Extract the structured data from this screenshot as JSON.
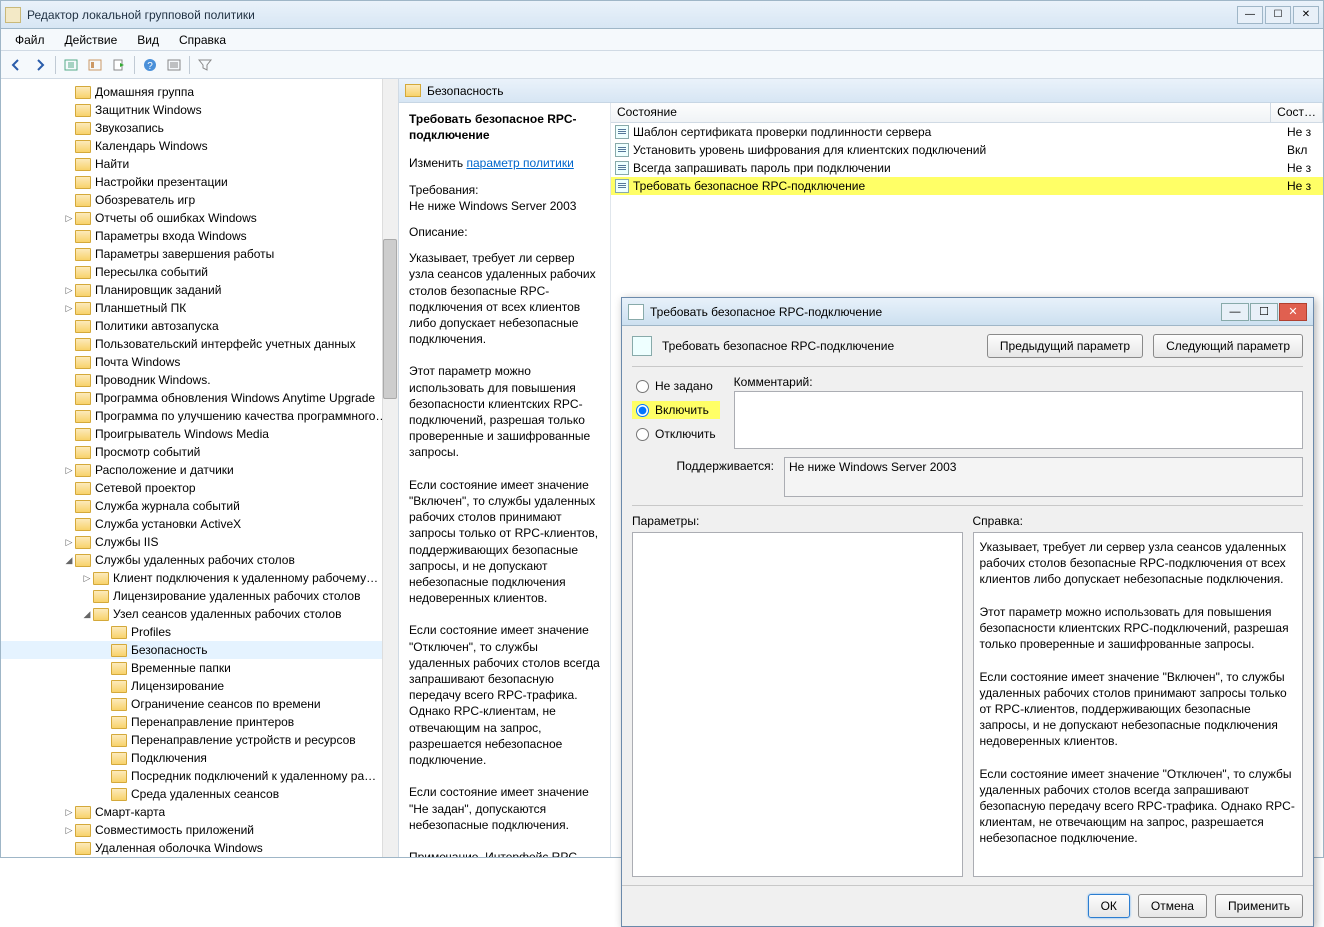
{
  "window": {
    "title": "Редактор локальной групповой политики"
  },
  "menubar": [
    "Файл",
    "Действие",
    "Вид",
    "Справка"
  ],
  "tree": [
    {
      "indent": 3,
      "exp": "",
      "label": "Домашняя группа"
    },
    {
      "indent": 3,
      "exp": "",
      "label": "Защитник Windows"
    },
    {
      "indent": 3,
      "exp": "",
      "label": "Звукозапись"
    },
    {
      "indent": 3,
      "exp": "",
      "label": "Календарь Windows"
    },
    {
      "indent": 3,
      "exp": "",
      "label": "Найти"
    },
    {
      "indent": 3,
      "exp": "",
      "label": "Настройки презентации"
    },
    {
      "indent": 3,
      "exp": "",
      "label": "Обозреватель игр"
    },
    {
      "indent": 3,
      "exp": "▷",
      "label": "Отчеты об ошибках Windows"
    },
    {
      "indent": 3,
      "exp": "",
      "label": "Параметры входа Windows"
    },
    {
      "indent": 3,
      "exp": "",
      "label": "Параметры завершения работы"
    },
    {
      "indent": 3,
      "exp": "",
      "label": "Пересылка событий"
    },
    {
      "indent": 3,
      "exp": "▷",
      "label": "Планировщик заданий"
    },
    {
      "indent": 3,
      "exp": "▷",
      "label": "Планшетный ПК"
    },
    {
      "indent": 3,
      "exp": "",
      "label": "Политики автозапуска"
    },
    {
      "indent": 3,
      "exp": "",
      "label": "Пользовательский интерфейс учетных данных"
    },
    {
      "indent": 3,
      "exp": "",
      "label": "Почта Windows"
    },
    {
      "indent": 3,
      "exp": "",
      "label": "Проводник Windows."
    },
    {
      "indent": 3,
      "exp": "",
      "label": "Программа обновления Windows Anytime Upgrade"
    },
    {
      "indent": 3,
      "exp": "",
      "label": "Программа по улучшению качества программного…"
    },
    {
      "indent": 3,
      "exp": "",
      "label": "Проигрыватель Windows Media"
    },
    {
      "indent": 3,
      "exp": "",
      "label": "Просмотр событий"
    },
    {
      "indent": 3,
      "exp": "▷",
      "label": "Расположение и датчики"
    },
    {
      "indent": 3,
      "exp": "",
      "label": "Сетевой проектор"
    },
    {
      "indent": 3,
      "exp": "",
      "label": "Служба журнала событий"
    },
    {
      "indent": 3,
      "exp": "",
      "label": "Служба установки ActiveX"
    },
    {
      "indent": 3,
      "exp": "▷",
      "label": "Службы IIS"
    },
    {
      "indent": 3,
      "exp": "◢",
      "label": "Службы удаленных рабочих столов"
    },
    {
      "indent": 4,
      "exp": "▷",
      "label": "Клиент подключения к удаленному рабочему…"
    },
    {
      "indent": 4,
      "exp": "",
      "label": "Лицензирование удаленных рабочих столов"
    },
    {
      "indent": 4,
      "exp": "◢",
      "label": "Узел сеансов удаленных рабочих столов"
    },
    {
      "indent": 5,
      "exp": "",
      "label": "Profiles"
    },
    {
      "indent": 5,
      "exp": "",
      "label": "Безопасность",
      "selected": true
    },
    {
      "indent": 5,
      "exp": "",
      "label": "Временные папки"
    },
    {
      "indent": 5,
      "exp": "",
      "label": "Лицензирование"
    },
    {
      "indent": 5,
      "exp": "",
      "label": "Ограничение сеансов по времени"
    },
    {
      "indent": 5,
      "exp": "",
      "label": "Перенаправление принтеров"
    },
    {
      "indent": 5,
      "exp": "",
      "label": "Перенаправление устройств и ресурсов"
    },
    {
      "indent": 5,
      "exp": "",
      "label": "Подключения"
    },
    {
      "indent": 5,
      "exp": "",
      "label": "Посредник подключений к удаленному ра…"
    },
    {
      "indent": 5,
      "exp": "",
      "label": "Среда удаленных сеансов"
    },
    {
      "indent": 3,
      "exp": "▷",
      "label": "Смарт-карта"
    },
    {
      "indent": 3,
      "exp": "▷",
      "label": "Совместимость приложений"
    },
    {
      "indent": 3,
      "exp": "",
      "label": "Удаленная оболочка Windows"
    }
  ],
  "rightHeader": "Безопасность",
  "detail": {
    "title": "Требовать безопасное RPC-подключение",
    "editLabel": "Изменить",
    "editLink": "параметр политики",
    "reqLabel": "Требования:",
    "reqValue": "Не ниже Windows Server 2003",
    "descLabel": "Описание:",
    "description": "Указывает, требует ли сервер узла сеансов удаленных рабочих столов безопасные RPC-подключения от всех клиентов либо допускает небезопасные подключения.\n\nЭтот параметр можно использовать для повышения безопасности клиентских RPC-подключений, разрешая только проверенные и зашифрованные запросы.\n\nЕсли состояние имеет значение \"Включен\", то службы удаленных рабочих столов принимают запросы только от RPC-клиентов, поддерживающих безопасные запросы, и не допускают небезопасные подключения недоверенных клиентов.\n\nЕсли состояние имеет значение \"Отключен\", то службы удаленных рабочих столов всегда запрашивают безопасную передачу всего RPC-трафика. Однако RPC-клиентам, не отвечающим на запрос, разрешается небезопасное подключение.\n\nЕсли состояние имеет значение \"Не задан\", допускаются небезопасные подключения.\n\nПримечание. Интерфейс RPC используется для администрирования и настройки"
  },
  "listHeader": {
    "name": "Состояние",
    "state": "Сост…"
  },
  "listRows": [
    {
      "label": "Шаблон сертификата проверки подлинности сервера",
      "state": "Не з"
    },
    {
      "label": "Установить уровень шифрования для клиентских подключений",
      "state": "Вкл"
    },
    {
      "label": "Всегда запрашивать пароль при подключении",
      "state": "Не з"
    },
    {
      "label": "Требовать безопасное RPC-подключение",
      "state": "Не з",
      "highlighted": true
    }
  ],
  "dialog": {
    "title": "Требовать безопасное RPC-подключение",
    "subtitle": "Требовать безопасное RPC-подключение",
    "prevBtn": "Предыдущий параметр",
    "nextBtn": "Следующий параметр",
    "radios": {
      "notset": "Не задано",
      "enable": "Включить",
      "disable": "Отключить"
    },
    "commentLabel": "Комментарий:",
    "supportLabel": "Поддерживается:",
    "supportValue": "Не ниже Windows Server 2003",
    "paramsLabel": "Параметры:",
    "helpLabel": "Справка:",
    "helpText": "Указывает, требует ли сервер узла сеансов удаленных рабочих столов безопасные RPC-подключения от всех клиентов либо допускает небезопасные подключения.\n\nЭтот параметр можно использовать для повышения безопасности клиентских RPC-подключений, разрешая только проверенные и зашифрованные запросы.\n\nЕсли состояние имеет значение \"Включен\", то службы удаленных рабочих столов принимают запросы только от RPC-клиентов, поддерживающих безопасные запросы, и не допускают небезопасные подключения недоверенных клиентов.\n\nЕсли состояние имеет значение \"Отключен\", то службы удаленных рабочих столов всегда запрашивают безопасную передачу всего RPC-трафика. Однако RPC-клиентам, не отвечающим на запрос, разрешается небезопасное подключение.",
    "ok": "ОК",
    "cancel": "Отмена",
    "apply": "Применить"
  }
}
